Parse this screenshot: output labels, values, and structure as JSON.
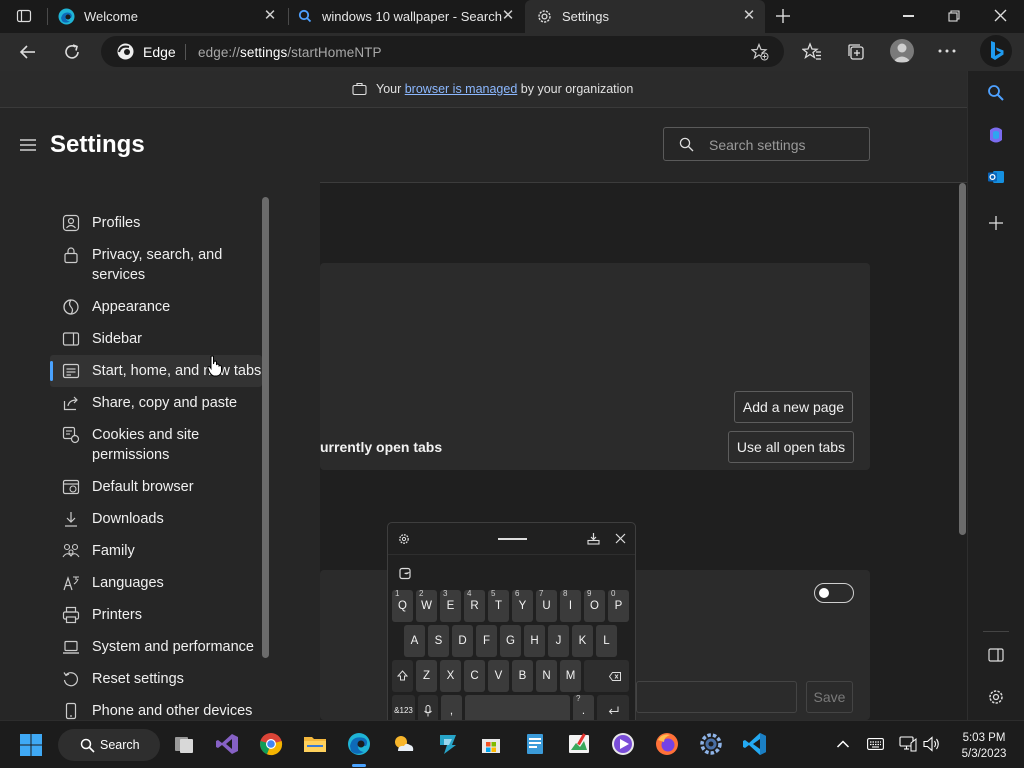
{
  "tabs": [
    {
      "title": "Welcome",
      "icon": "edge-icon"
    },
    {
      "title": "windows 10 wallpaper - Search",
      "icon": "search-icon"
    },
    {
      "title": "Settings",
      "icon": "gear-icon",
      "active": true
    }
  ],
  "toolbar": {
    "brand": "Edge",
    "url_prefix": "edge://",
    "url_host": "settings",
    "url_path": "/startHomeNTP"
  },
  "banner": {
    "pre": "Your ",
    "link": "browser is managed",
    "post": " by your organization"
  },
  "settings": {
    "title": "Settings",
    "search_placeholder": "Search settings",
    "nav": [
      {
        "label": "Profiles",
        "icon": "profile-icon"
      },
      {
        "label": "Privacy, search, and services",
        "icon": "lock-icon"
      },
      {
        "label": "Appearance",
        "icon": "appearance-icon"
      },
      {
        "label": "Sidebar",
        "icon": "sidebar-icon"
      },
      {
        "label": "Start, home, and new tabs",
        "icon": "home-tabs-icon",
        "selected": true
      },
      {
        "label": "Share, copy and paste",
        "icon": "share-icon"
      },
      {
        "label": "Cookies and site permissions",
        "icon": "cookies-icon"
      },
      {
        "label": "Default browser",
        "icon": "browser-icon"
      },
      {
        "label": "Downloads",
        "icon": "download-icon"
      },
      {
        "label": "Family",
        "icon": "family-icon"
      },
      {
        "label": "Languages",
        "icon": "language-icon"
      },
      {
        "label": "Printers",
        "icon": "printer-icon"
      },
      {
        "label": "System and performance",
        "icon": "laptop-icon"
      },
      {
        "label": "Reset settings",
        "icon": "reset-icon"
      },
      {
        "label": "Phone and other devices",
        "icon": "phone-icon"
      }
    ]
  },
  "main": {
    "partial_label": "urrently open tabs",
    "add_page_button": "Add a new page",
    "use_all_tabs_button": "Use all open tabs",
    "save_button": "Save",
    "toggle_state": "off"
  },
  "keyboard": {
    "row1": [
      {
        "k": "Q",
        "s": "1"
      },
      {
        "k": "W",
        "s": "2"
      },
      {
        "k": "E",
        "s": "3"
      },
      {
        "k": "R",
        "s": "4"
      },
      {
        "k": "T",
        "s": "5"
      },
      {
        "k": "Y",
        "s": "6"
      },
      {
        "k": "U",
        "s": "7"
      },
      {
        "k": "I",
        "s": "8"
      },
      {
        "k": "O",
        "s": "9"
      },
      {
        "k": "P",
        "s": "0"
      }
    ],
    "row2": [
      "A",
      "S",
      "D",
      "F",
      "G",
      "H",
      "J",
      "K",
      "L"
    ],
    "row3": [
      "Z",
      "X",
      "C",
      "V",
      "B",
      "N",
      "M"
    ],
    "mode_key": "&123",
    "comma_key": ",",
    "period_key": ".",
    "period_sub": "?"
  },
  "taskbar": {
    "search_label": "Search",
    "time": "5:03 PM",
    "date": "5/3/2023"
  },
  "colors": {
    "accent": "#4aa3ff",
    "link": "#8cb8ff",
    "background": "#202020"
  }
}
